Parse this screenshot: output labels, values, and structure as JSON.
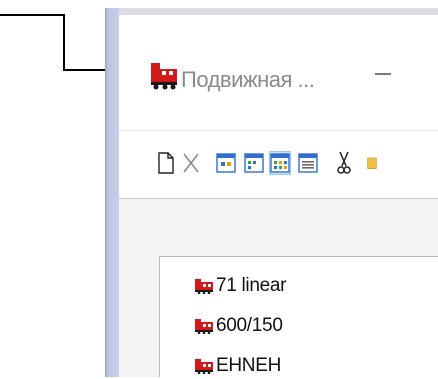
{
  "window": {
    "title": "Подвижная ...",
    "minimize_glyph": "—"
  },
  "toolbar": {
    "buttons": [
      {
        "name": "new-document-icon",
        "active": false
      },
      {
        "name": "delete-icon",
        "active": false
      },
      {
        "name": "view-large-icons",
        "active": false
      },
      {
        "name": "view-small-icons",
        "active": false
      },
      {
        "name": "view-list-icon",
        "active": true
      },
      {
        "name": "view-details-icon",
        "active": false
      },
      {
        "name": "cut-icon",
        "active": false
      },
      {
        "name": "paste-icon",
        "active": false
      }
    ]
  },
  "list": {
    "items": [
      {
        "label": "71 linear",
        "icon": "locomotive-icon"
      },
      {
        "label": "600/150",
        "icon": "locomotive-icon"
      },
      {
        "label": "EHNEH",
        "icon": "locomotive-icon"
      }
    ]
  },
  "colors": {
    "icon_red": "#d11a1a",
    "icon_dark": "#1a1a1a",
    "active_button": "#cce4f7",
    "window_frame": "#c4d2ee"
  }
}
